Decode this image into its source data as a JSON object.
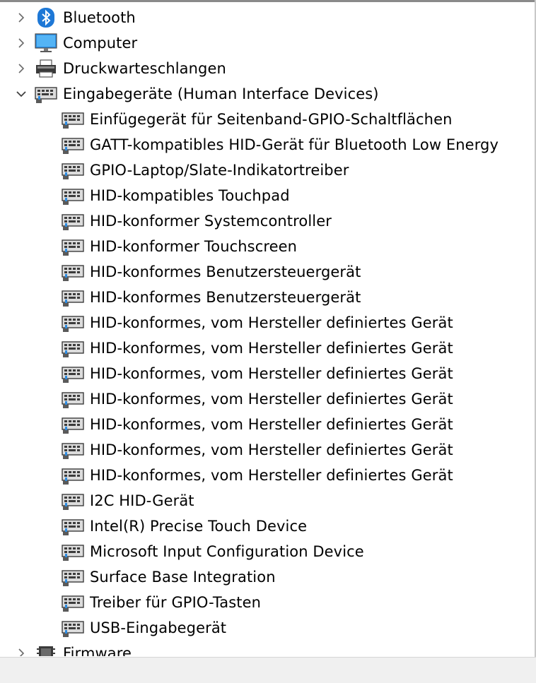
{
  "tree": {
    "categories": [
      {
        "label": "Bluetooth",
        "icon": "bluetooth-icon",
        "expanded": false
      },
      {
        "label": "Computer",
        "icon": "computer-monitor-icon",
        "expanded": false
      },
      {
        "label": "Druckwarteschlangen",
        "icon": "printer-icon",
        "expanded": false
      },
      {
        "label": "Eingabegeräte (Human Interface Devices)",
        "icon": "hid-device-icon",
        "expanded": true
      },
      {
        "label": "Firmware",
        "icon": "firmware-chip-icon",
        "expanded": false
      }
    ],
    "hid_devices": [
      "Einfügegerät für Seitenband-GPIO-Schaltflächen",
      "GATT-kompatibles HID-Gerät für Bluetooth Low Energy",
      "GPIO-Laptop/Slate-Indikatortreiber",
      "HID-kompatibles Touchpad",
      "HID-konformer Systemcontroller",
      "HID-konformer Touchscreen",
      "HID-konformes Benutzersteuergerät",
      "HID-konformes Benutzersteuergerät",
      "HID-konformes, vom Hersteller definiertes Gerät",
      "HID-konformes, vom Hersteller definiertes Gerät",
      "HID-konformes, vom Hersteller definiertes Gerät",
      "HID-konformes, vom Hersteller definiertes Gerät",
      "HID-konformes, vom Hersteller definiertes Gerät",
      "HID-konformes, vom Hersteller definiertes Gerät",
      "HID-konformes, vom Hersteller definiertes Gerät",
      "I2C HID-Gerät",
      "Intel(R) Precise Touch Device",
      "Microsoft Input Configuration Device",
      "Surface Base Integration",
      "Treiber für GPIO-Tasten",
      "USB-Eingabegerät"
    ]
  },
  "colors": {
    "bluetooth": "#1e78d6",
    "chevron": "#6b6b6b",
    "statusbar": "#f0f0f0"
  }
}
